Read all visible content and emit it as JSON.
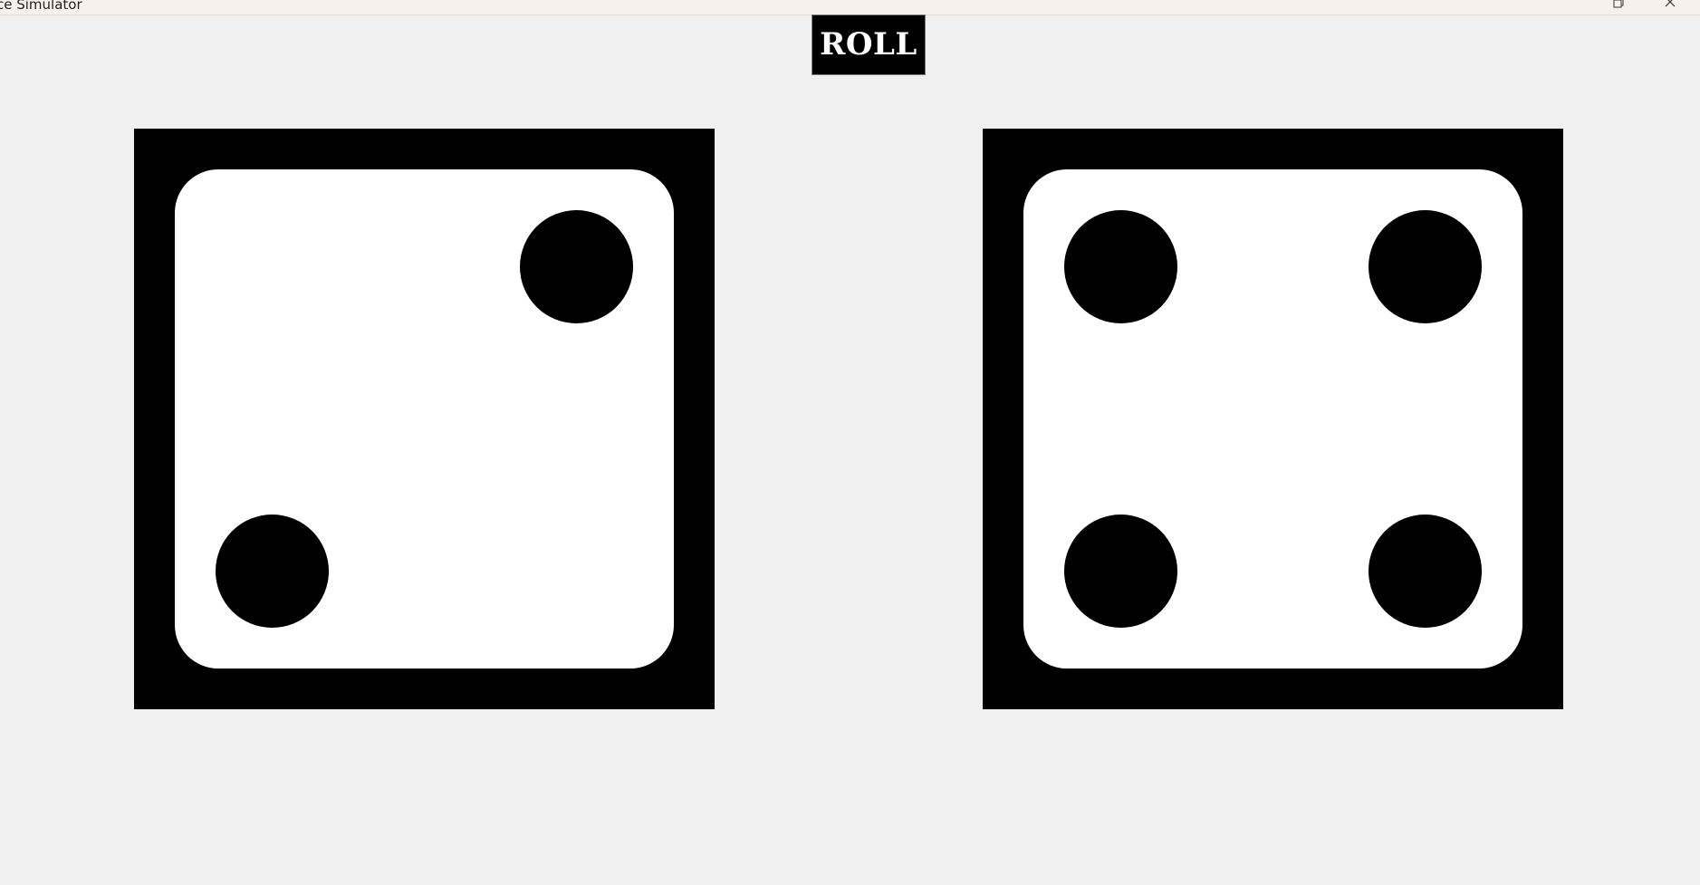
{
  "window": {
    "title": "ce Simulator",
    "restore_icon": "restore-icon",
    "close_icon": "close-icon"
  },
  "roll_button": {
    "label": "ROLL"
  },
  "dice": [
    {
      "value": 2,
      "pips": [
        "top-right",
        "bottom-left"
      ]
    },
    {
      "value": 4,
      "pips": [
        "top-left",
        "top-right",
        "bottom-left",
        "bottom-right"
      ]
    }
  ],
  "colors": {
    "background": "#f0f0f0",
    "die_border": "#000000",
    "die_face": "#ffffff",
    "pip": "#000000",
    "button_bg": "#000000",
    "button_text": "#ffffff"
  }
}
